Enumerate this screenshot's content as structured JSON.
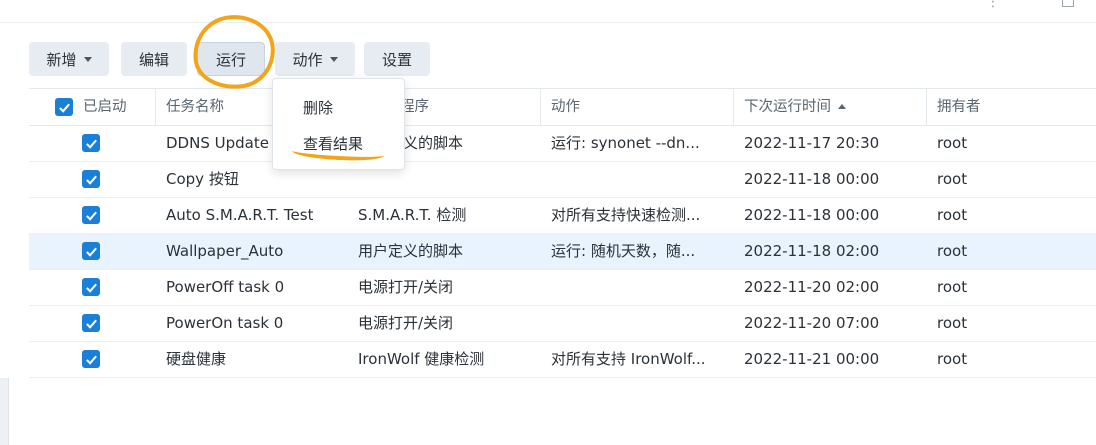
{
  "toolbar": {
    "new_label": "新增",
    "edit_label": "编辑",
    "run_label": "运行",
    "action_label": "动作",
    "settings_label": "设置"
  },
  "table": {
    "columns": {
      "enabled": "已启动",
      "name": "任务名称",
      "type": "程序",
      "action": "动作",
      "next_run": "下次运行时间",
      "owner": "拥有者"
    },
    "rows": [
      {
        "enabled": true,
        "name": "DDNS Update",
        "type": "用户定义的脚本",
        "action": "运行: synonet --dn...",
        "next_run": "2022-11-17 20:30",
        "owner": "root",
        "selected": false
      },
      {
        "enabled": true,
        "name": "Copy 按钮",
        "type": "",
        "action": "",
        "next_run": "2022-11-18 00:00",
        "owner": "root",
        "selected": false
      },
      {
        "enabled": true,
        "name": "Auto S.M.A.R.T. Test",
        "type": "S.M.A.R.T. 检测",
        "action": "对所有支持快速检测...",
        "next_run": "2022-11-18 00:00",
        "owner": "root",
        "selected": false
      },
      {
        "enabled": true,
        "name": "Wallpaper_Auto",
        "type": "用户定义的脚本",
        "action": "运行: 随机天数，随...",
        "next_run": "2022-11-18 02:00",
        "owner": "root",
        "selected": true
      },
      {
        "enabled": true,
        "name": "PowerOff task 0",
        "type": "电源打开/关闭",
        "action": "",
        "next_run": "2022-11-20 02:00",
        "owner": "root",
        "selected": false
      },
      {
        "enabled": true,
        "name": "PowerOn task 0",
        "type": "电源打开/关闭",
        "action": "",
        "next_run": "2022-11-20 07:00",
        "owner": "root",
        "selected": false
      },
      {
        "enabled": true,
        "name": "硬盘健康",
        "type": "IronWolf 健康检测",
        "action": "对所有支持 IronWolf...",
        "next_run": "2022-11-21 00:00",
        "owner": "root",
        "selected": false
      }
    ]
  },
  "dropdown": {
    "items": [
      "删除",
      "查看结果"
    ]
  },
  "colors": {
    "accent": "#1a7fd6",
    "annotation": "#f2a51a",
    "selected_row": "#e8f3fd",
    "button_bg": "#e6ecf2"
  }
}
